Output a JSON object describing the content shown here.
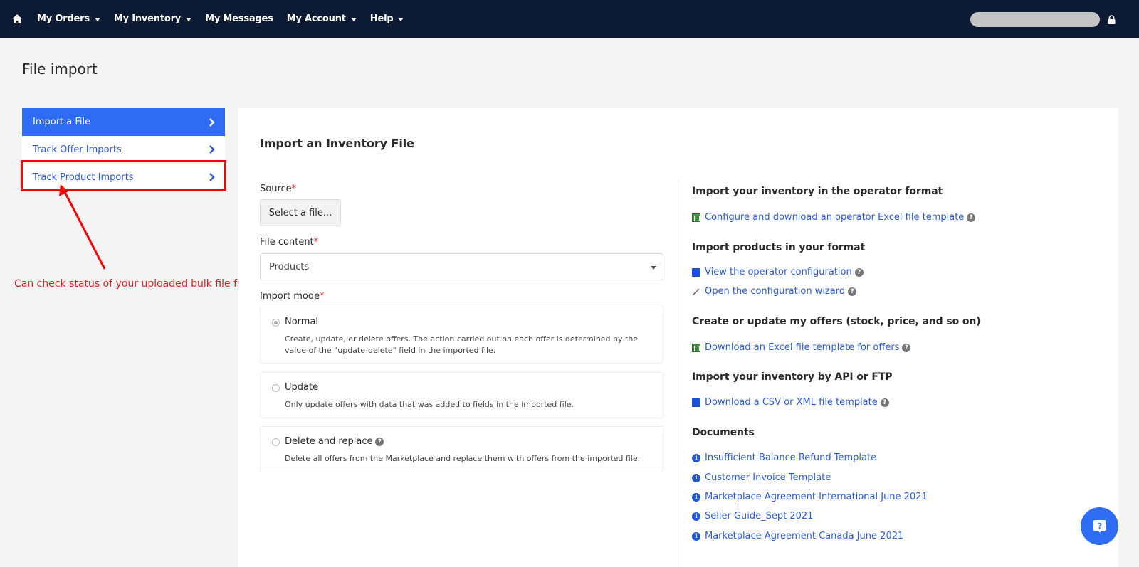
{
  "nav": {
    "items": [
      {
        "label": "My Orders",
        "has_caret": true
      },
      {
        "label": "My Inventory",
        "has_caret": true
      },
      {
        "label": "My Messages",
        "has_caret": false
      },
      {
        "label": "My Account",
        "has_caret": true
      },
      {
        "label": "Help",
        "has_caret": true
      }
    ]
  },
  "page": {
    "title": "File import"
  },
  "menu": {
    "items": [
      {
        "label": "Import a File",
        "active": true
      },
      {
        "label": "Track Offer Imports",
        "active": false
      },
      {
        "label": "Track Product Imports",
        "active": false
      }
    ]
  },
  "annotation": {
    "text": "Can check status of your uploaded bulk file from Track Product Import"
  },
  "form": {
    "title": "Import an Inventory File",
    "source_label": "Source",
    "select_file_label": "Select a file...",
    "file_content_label": "File content",
    "file_content_value": "Products",
    "import_mode_label": "Import mode",
    "required_mark": "*",
    "modes": [
      {
        "name": "Normal",
        "checked": true,
        "desc": "Create, update, or delete offers. The action carried out on each offer is determined by the value of the \"update-delete\" field in the imported file."
      },
      {
        "name": "Update",
        "checked": false,
        "desc": "Only update offers with data that was added to fields in the imported file."
      },
      {
        "name": "Delete and replace",
        "checked": false,
        "desc": "Delete all offers from the Marketplace and replace them with offers from the imported file."
      }
    ]
  },
  "right": {
    "operator_format": {
      "heading": "Import your inventory in the operator format",
      "link": "Configure and download an operator Excel file template"
    },
    "your_format": {
      "heading": "Import products in your format",
      "link1": "View the operator configuration",
      "link2": "Open the configuration wizard"
    },
    "offers": {
      "heading": "Create or update my offers (stock, price, and so on)",
      "link": "Download an Excel file template for offers"
    },
    "api": {
      "heading": "Import your inventory by API or FTP",
      "link": "Download a CSV or XML file template"
    },
    "documents": {
      "heading": "Documents",
      "items": [
        "Insufficient Balance Refund Template",
        "Customer Invoice Template",
        "Marketplace Agreement International June 2021",
        "Seller Guide_Sept 2021",
        "Marketplace Agreement Canada June 2021"
      ]
    }
  },
  "colors": {
    "nav_bg": "#0d1a33",
    "accent": "#2e6cf3",
    "link": "#2d5ad6",
    "annotation": "#e02020"
  }
}
